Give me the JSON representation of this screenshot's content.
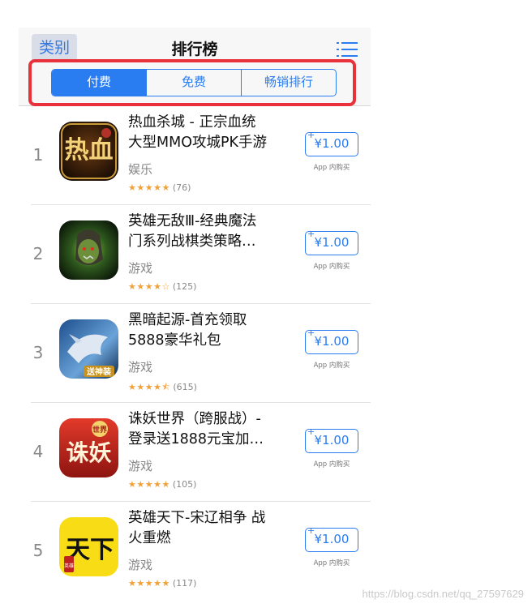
{
  "nav": {
    "back_label": "类别",
    "title": "排行榜"
  },
  "segments": [
    {
      "label": "付费",
      "active": true
    },
    {
      "label": "免费",
      "active": false
    },
    {
      "label": "畅销排行",
      "active": false
    }
  ],
  "apps": [
    {
      "rank": "1",
      "name": "热血杀城 - 正宗血统\n大型MMO攻城PK手游",
      "category": "娱乐",
      "stars": "★★★★★",
      "rating_count": "(76)",
      "price": "¥1.00",
      "iap": "App 内购买",
      "icon": "game-icon-rexue",
      "icon_text": "热血"
    },
    {
      "rank": "2",
      "name": "英雄无敌Ⅲ-经典魔法\n门系列战棋类策略…",
      "category": "游戏",
      "stars": "★★★★☆",
      "rating_count": "(125)",
      "price": "¥1.00",
      "iap": "App 内购买",
      "icon": "game-icon-orc",
      "icon_text": ""
    },
    {
      "rank": "3",
      "name": "黑暗起源-首充领取\n5888豪华礼包",
      "category": "游戏",
      "stars": "★★★★⯪",
      "rating_count": "(615)",
      "price": "¥1.00",
      "iap": "App 内购买",
      "icon": "game-icon-dragon",
      "icon_text": "送神装"
    },
    {
      "rank": "4",
      "name": "诛妖世界（跨服战）-\n登录送1888元宝加…",
      "category": "游戏",
      "stars": "★★★★★",
      "rating_count": "(105)",
      "price": "¥1.00",
      "iap": "App 内购买",
      "icon": "game-icon-zhuyao",
      "icon_text": "诛妖",
      "icon_badge": "世界"
    },
    {
      "rank": "5",
      "name": "英雄天下-宋辽相争 战\n火重燃",
      "category": "游戏",
      "stars": "★★★★★",
      "rating_count": "(117)",
      "price": "¥1.00",
      "iap": "App 内购买",
      "icon": "game-icon-tianxia",
      "icon_text": "天下",
      "icon_badge": "英雄"
    }
  ],
  "price_plus": "+",
  "watermark": "https://blog.csdn.net/qq_27597629"
}
